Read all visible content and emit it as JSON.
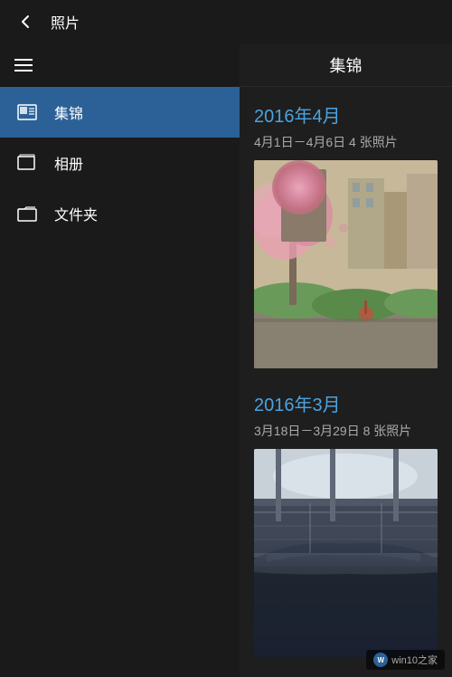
{
  "titleBar": {
    "backLabel": "←",
    "title": "照片"
  },
  "sidebar": {
    "items": [
      {
        "id": "highlights",
        "label": "集锦",
        "active": true
      },
      {
        "id": "albums",
        "label": "相册",
        "active": false
      },
      {
        "id": "folders",
        "label": "文件夹",
        "active": false
      }
    ]
  },
  "content": {
    "title": "集锦",
    "sections": [
      {
        "yearMonth": "2016年4月",
        "meta": "4月1日－4月6日   4 张照片"
      },
      {
        "yearMonth": "2016年3月",
        "meta": "3月18日－3月29日   8 张照片"
      }
    ]
  },
  "watermark": {
    "logo": "W",
    "text": "win10之家"
  }
}
